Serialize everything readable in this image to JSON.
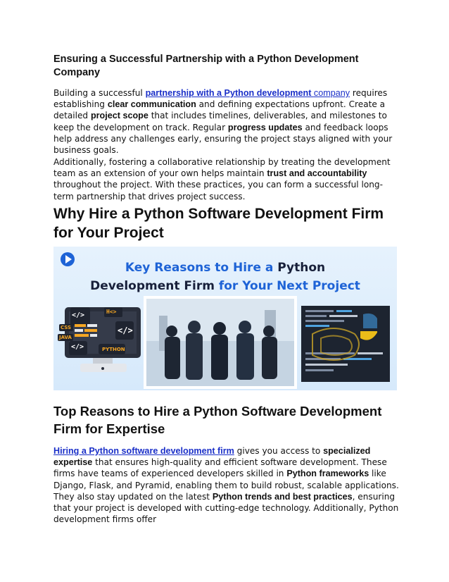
{
  "section1": {
    "heading": "Ensuring a Successful Partnership with a Python Development Company",
    "p1": {
      "t1": "Building a successful ",
      "link_bold": "partnership with a Python development ",
      "link_thin": "company",
      "t2": " requires establishing ",
      "b1": "clear communication",
      "t3": " and defining expectations upfront. Create a detailed ",
      "b2": "project scope",
      "t4": " that includes timelines, deliverables, and milestones to keep the development on track. Regular ",
      "b3": "progress updates",
      "t5": " and feedback loops help address any challenges early, ensuring the project stays aligned with your business goals."
    },
    "p2": {
      "t1": "Additionally, fostering a collaborative relationship by treating the development team as an extension of your own helps maintain ",
      "b1": "trust and accountability",
      "t2": " throughout the project. With these practices, you can form a successful long-term partnership that drives project success."
    }
  },
  "section2": {
    "heading": "Why Hire a Python Software Development Firm for Your Project"
  },
  "banner": {
    "line1_blue": "Key Reasons to Hire a ",
    "line1_dark": "Python",
    "line2_dark": "Development Firm ",
    "line2_blue": "for Your Next Project",
    "monitor_labels": {
      "code1": "</>",
      "h_tag": "H<>",
      "css": "CSS",
      "java": "JAVA",
      "code2": "</>",
      "code3": "</>",
      "python": "PYTHON"
    }
  },
  "section3": {
    "heading": "Top Reasons to Hire a Python Software Development Firm for Expertise",
    "p1": {
      "link": "Hiring a Python software development firm",
      "t1": " gives you access to ",
      "b1": "specialized expertise",
      "t2": " that ensures high-quality and efficient software development. These firms have teams of experienced developers skilled in ",
      "b2": "Python frameworks",
      "t3": " like Django, Flask, and Pyramid, enabling them to build robust, scalable applications. They also stay updated on the latest ",
      "b3": "Python trends and best practices",
      "t4": ", ensuring that your project is developed with cutting-edge technology. Additionally, Python development firms offer"
    }
  },
  "colors": {
    "link": "#1a2fc8",
    "banner_blue": "#1e63d6",
    "banner_dark": "#18203a",
    "python_yellow": "#f5c518",
    "python_blue": "#3572a5"
  }
}
